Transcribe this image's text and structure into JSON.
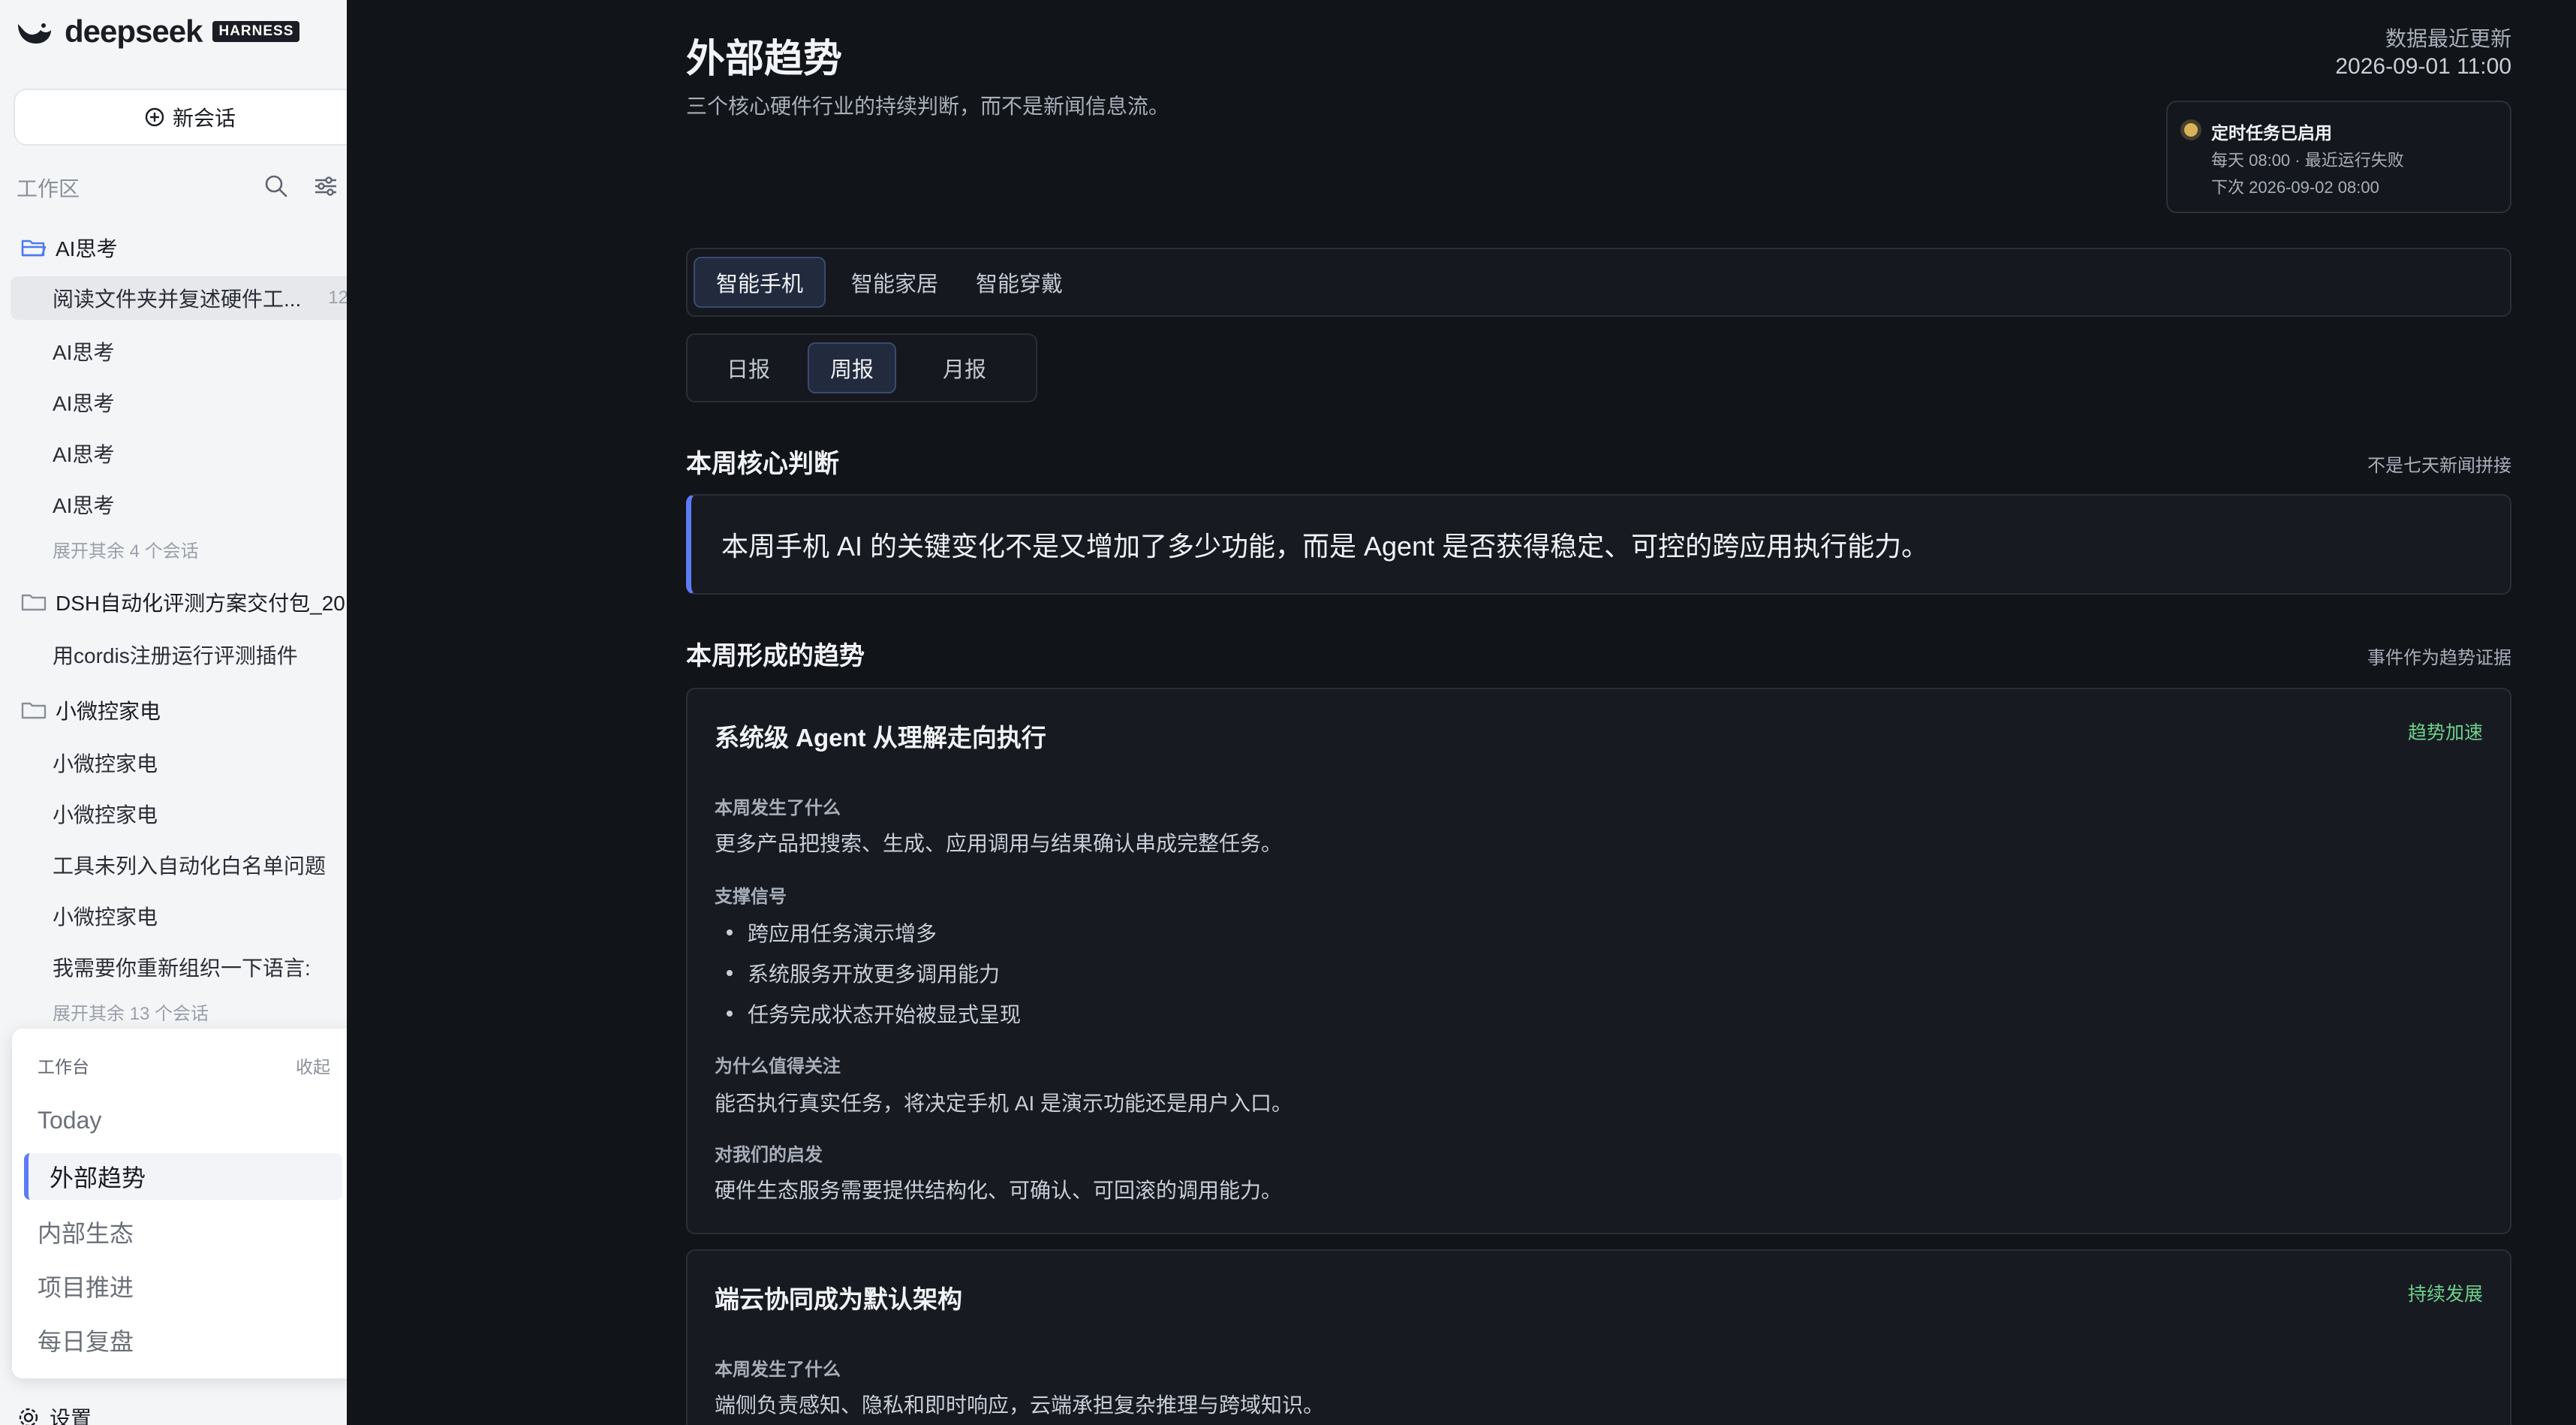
{
  "brand": {
    "name": "deepseek",
    "badge": "HARNESS"
  },
  "sidebar": {
    "new_chat": "新会话",
    "workspace_label": "工作区",
    "folders": [
      {
        "name": "AI思考",
        "items": [
          {
            "label": "阅读文件夹并复述硬件工...",
            "count": "12"
          },
          {
            "label": "AI思考"
          },
          {
            "label": "AI思考"
          },
          {
            "label": "AI思考"
          },
          {
            "label": "AI思考"
          }
        ],
        "more": "展开其余 4 个会话"
      },
      {
        "name": "DSH自动化评测方案交付包_20",
        "items": [
          {
            "label": "用cordis注册运行评测插件"
          }
        ]
      },
      {
        "name": "小微控家电",
        "items": [
          {
            "label": "小微控家电"
          },
          {
            "label": "小微控家电"
          },
          {
            "label": "工具未列入自动化白名单问题"
          },
          {
            "label": "小微控家电"
          },
          {
            "label": "我需要你重新组织一下语言:"
          }
        ],
        "more": "展开其余 13 个会话"
      }
    ],
    "panel": {
      "title": "工作台",
      "collapse": "收起",
      "items": [
        "Today",
        "外部趋势",
        "内部生态",
        "项目推进",
        "每日复盘"
      ]
    },
    "settings": "设置"
  },
  "main": {
    "title": "外部趋势",
    "subtitle": "三个核心硬件行业的持续判断，而不是新闻信息流。",
    "update_label": "数据最近更新",
    "update_time": "2026-09-01 11:00",
    "schedule": {
      "title": "定时任务已启用",
      "line1": "每天 08:00 · 最近运行失败",
      "line2": "下次 2026-09-02 08:00"
    },
    "category_tabs": [
      "智能手机",
      "智能家居",
      "智能穿戴"
    ],
    "period_tabs": [
      "日报",
      "周报",
      "月报"
    ],
    "core_section": {
      "title": "本周核心判断",
      "note": "不是七天新闻拼接",
      "text": "本周手机 AI 的关键变化不是又增加了多少功能，而是 Agent 是否获得稳定、可控的跨应用执行能力。"
    },
    "trend_section": {
      "title": "本周形成的趋势",
      "note": "事件作为趋势证据"
    },
    "cards": [
      {
        "title": "系统级 Agent 从理解走向执行",
        "badge": "趋势加速",
        "what_label": "本周发生了什么",
        "what_text": "更多产品把搜索、生成、应用调用与结果确认串成完整任务。",
        "signals_label": "支撑信号",
        "signals": [
          "跨应用任务演示增多",
          "系统服务开放更多调用能力",
          "任务完成状态开始被显式呈现"
        ],
        "why_label": "为什么值得关注",
        "why_text": "能否执行真实任务，将决定手机 AI 是演示功能还是用户入口。",
        "insight_label": "对我们的启发",
        "insight_text": "硬件生态服务需要提供结构化、可确认、可回滚的调用能力。"
      },
      {
        "title": "端云协同成为默认架构",
        "badge": "持续发展",
        "what_label": "本周发生了什么",
        "what_text": "端侧负责感知、隐私和即时响应，云端承担复杂推理与跨域知识。"
      }
    ]
  }
}
